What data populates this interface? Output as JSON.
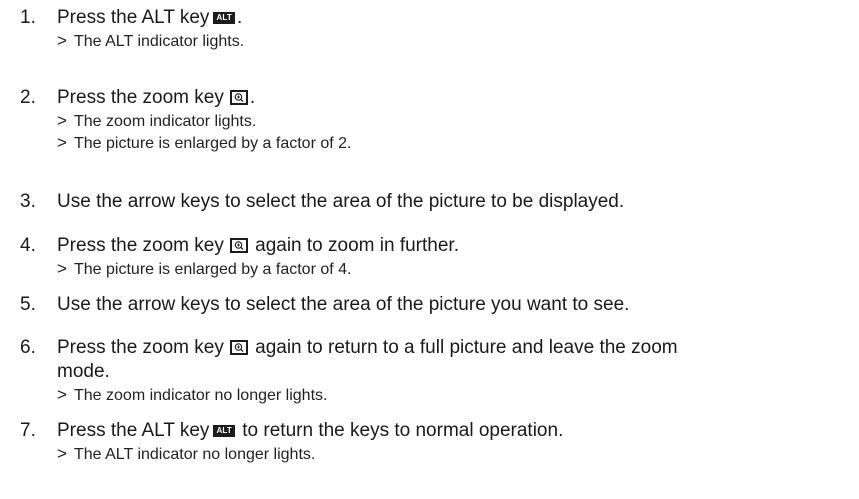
{
  "steps": [
    {
      "number": "1.",
      "before": "Press the ALT key",
      "key": "alt",
      "key_label": "ALT",
      "after": ".",
      "results": [
        "The ALT indicator lights."
      ]
    },
    {
      "number": "2.",
      "before": "Press the zoom key",
      "key": "zoom",
      "after": ".",
      "results": [
        "The zoom indicator lights.",
        "The picture is enlarged by a factor of 2."
      ]
    },
    {
      "number": "3.",
      "text": "Use the arrow keys to select the area of the picture to be displayed.",
      "results": []
    },
    {
      "number": "4.",
      "before": "Press the zoom key",
      "key": "zoom",
      "after": "again to zoom in further.",
      "results": [
        "The picture is enlarged by a factor of 4."
      ]
    },
    {
      "number": "5.",
      "text": "Use the arrow keys to select the area of the picture you want to see.",
      "results": []
    },
    {
      "number": "6.",
      "before": "Press the zoom key",
      "key": "zoom",
      "after": "again to return to a full picture and leave the zoom",
      "continuation": "mode.",
      "results": [
        "The zoom indicator no longer lights."
      ]
    },
    {
      "number": "7.",
      "before": "Press the ALT key",
      "key": "alt",
      "key_label": "ALT",
      "after": "to return the keys to normal operation.",
      "results": [
        "The ALT indicator no longer lights."
      ]
    }
  ],
  "result_marker": ">"
}
